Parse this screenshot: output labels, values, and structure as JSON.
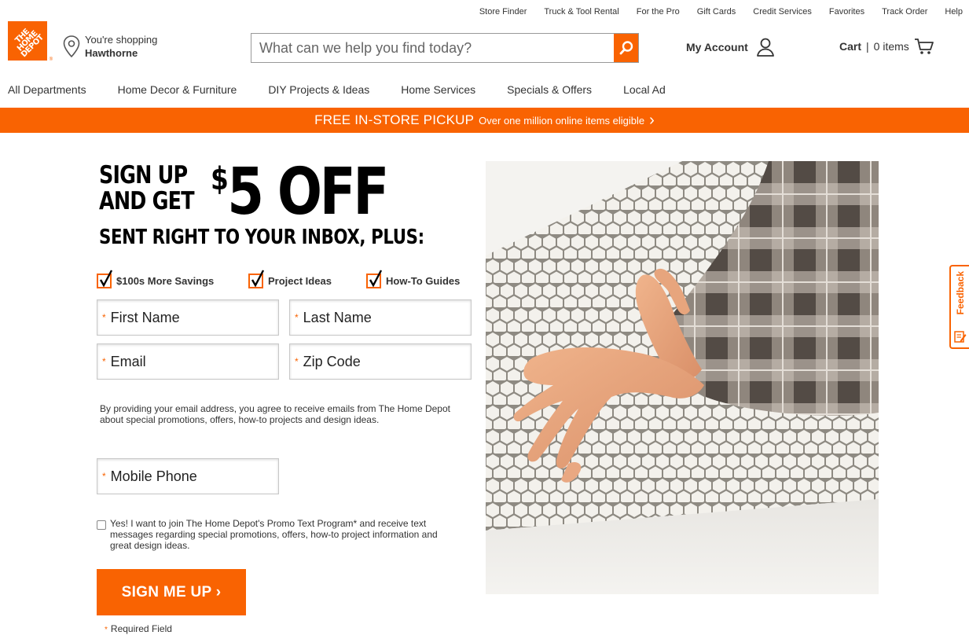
{
  "utility_nav": [
    "Store Finder",
    "Truck & Tool Rental",
    "For the Pro",
    "Gift Cards",
    "Credit Services",
    "Favorites",
    "Track Order",
    "Help"
  ],
  "logo": {
    "text": "THE HOME DEPOT"
  },
  "store": {
    "label": "You're shopping",
    "name": "Hawthorne"
  },
  "search": {
    "placeholder": "What can we help you find today?"
  },
  "account": {
    "label": "My Account"
  },
  "cart": {
    "label": "Cart",
    "count": "0 items",
    "separator": "|"
  },
  "main_nav": [
    "All Departments",
    "Home Decor & Furniture",
    "DIY Projects & Ideas",
    "Home Services",
    "Specials & Offers",
    "Local Ad"
  ],
  "promo": {
    "main": "FREE IN-STORE PICKUP",
    "sub": "Over one million online items eligible",
    "arrow": "›"
  },
  "headline": {
    "line1a": "SIGN UP",
    "line1b": "AND GET",
    "dollar": "$",
    "amount": "5 OFF",
    "line2": "SENT RIGHT TO YOUR INBOX, PLUS:"
  },
  "benefits": [
    "$100s More Savings",
    "Project Ideas",
    "How-To Guides"
  ],
  "form": {
    "required_mark": "*",
    "first_name": "First Name",
    "last_name": "Last Name",
    "email": "Email",
    "zip": "Zip Code",
    "mobile": "Mobile Phone",
    "disclaimer": "By providing your email address, you agree to receive emails from The Home Depot about special promotions, offers, how-to projects and design ideas.",
    "sms_consent": "Yes! I want to join The Home Depot's Promo Text Program* and receive text messages regarding special promotions, offers, how-to project information and great design ideas.",
    "submit": "SIGN ME UP ›",
    "required_note": "Required Field"
  },
  "feedback": {
    "label": "Feedback"
  },
  "colors": {
    "brand_orange": "#f96302"
  }
}
